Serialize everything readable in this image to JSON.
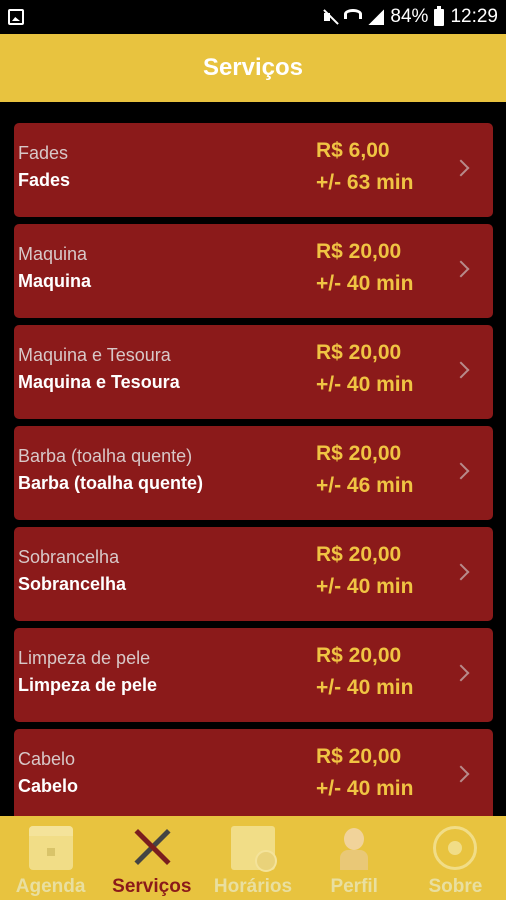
{
  "status_bar": {
    "battery": "84%",
    "time": "12:29"
  },
  "header": {
    "title": "Serviços"
  },
  "services": [
    {
      "name_sub": "Fades",
      "name": "Fades",
      "price": "R$ 6,00",
      "duration": "+/- 63 min"
    },
    {
      "name_sub": "Maquina",
      "name": "Maquina",
      "price": "R$ 20,00",
      "duration": "+/- 40 min"
    },
    {
      "name_sub": "Maquina e Tesoura",
      "name": "Maquina e Tesoura",
      "price": "R$ 20,00",
      "duration": "+/- 40 min"
    },
    {
      "name_sub": "Barba (toalha quente)",
      "name": "Barba (toalha quente)",
      "price": "R$ 20,00",
      "duration": "+/- 46 min"
    },
    {
      "name_sub": "Sobrancelha",
      "name": "Sobrancelha",
      "price": "R$ 20,00",
      "duration": "+/- 40 min"
    },
    {
      "name_sub": "Limpeza de pele",
      "name": "Limpeza de pele",
      "price": "R$ 20,00",
      "duration": "+/- 40 min"
    },
    {
      "name_sub": "Cabelo",
      "name": "Cabelo",
      "price": "R$ 20,00",
      "duration": "+/- 40 min"
    }
  ],
  "bottom_nav": [
    {
      "label": "Agenda",
      "icon": "calendar-icon",
      "active": false
    },
    {
      "label": "Serviços",
      "icon": "scissors-icon",
      "active": true
    },
    {
      "label": "Horários",
      "icon": "schedule-icon",
      "active": false
    },
    {
      "label": "Perfil",
      "icon": "profile-icon",
      "active": false
    },
    {
      "label": "Sobre",
      "icon": "about-icon",
      "active": false
    }
  ],
  "colors": {
    "accent": "#e8c33f",
    "card": "#8b1a1a",
    "price": "#f0c443"
  }
}
